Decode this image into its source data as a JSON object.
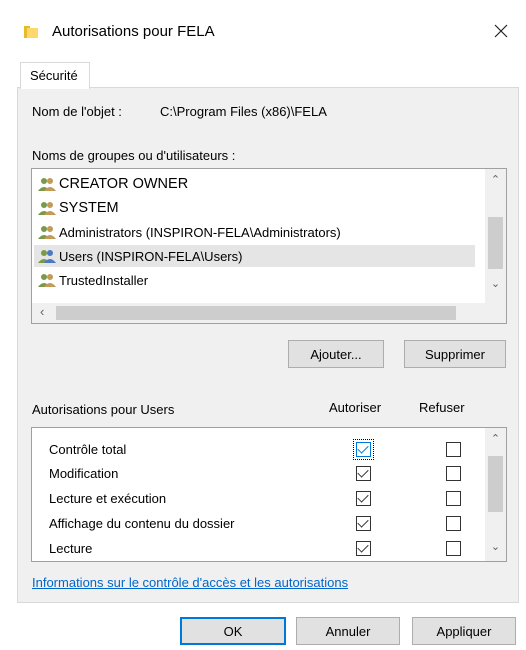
{
  "window": {
    "title": "Autorisations pour FELA",
    "icon": "folder-icon",
    "close_icon": "close-icon"
  },
  "tab": {
    "label": "Sécurité"
  },
  "object": {
    "label": "Nom de l'objet :",
    "value": "C:\\Program Files (x86)\\FELA"
  },
  "groups": {
    "label": "Noms de groupes ou d'utilisateurs :",
    "items": [
      {
        "name": "CREATOR OWNER",
        "selected": false
      },
      {
        "name": "SYSTEM",
        "selected": false
      },
      {
        "name": "Administrators (INSPIRON-FELA\\Administrators)",
        "selected": false
      },
      {
        "name": "Users (INSPIRON-FELA\\Users)",
        "selected": true
      },
      {
        "name": "TrustedInstaller",
        "selected": false
      }
    ]
  },
  "buttons": {
    "add": "Ajouter...",
    "remove": "Supprimer",
    "ok": "OK",
    "cancel": "Annuler",
    "apply": "Appliquer"
  },
  "permissions": {
    "label": "Autorisations pour Users",
    "allow_header": "Autoriser",
    "deny_header": "Refuser",
    "rows": [
      {
        "name": "Contrôle total",
        "allow": true,
        "deny": false
      },
      {
        "name": "Modification",
        "allow": true,
        "deny": false
      },
      {
        "name": "Lecture et exécution",
        "allow": true,
        "deny": false
      },
      {
        "name": "Affichage du contenu du dossier",
        "allow": true,
        "deny": false
      },
      {
        "name": "Lecture",
        "allow": true,
        "deny": false
      }
    ]
  },
  "link": {
    "text": "Informations sur le contrôle d'accès et les autorisations"
  },
  "colors": {
    "accent": "#0078d7",
    "link": "#0066cc",
    "selection": "#e5e5e5",
    "panel": "#f0f0f0"
  }
}
